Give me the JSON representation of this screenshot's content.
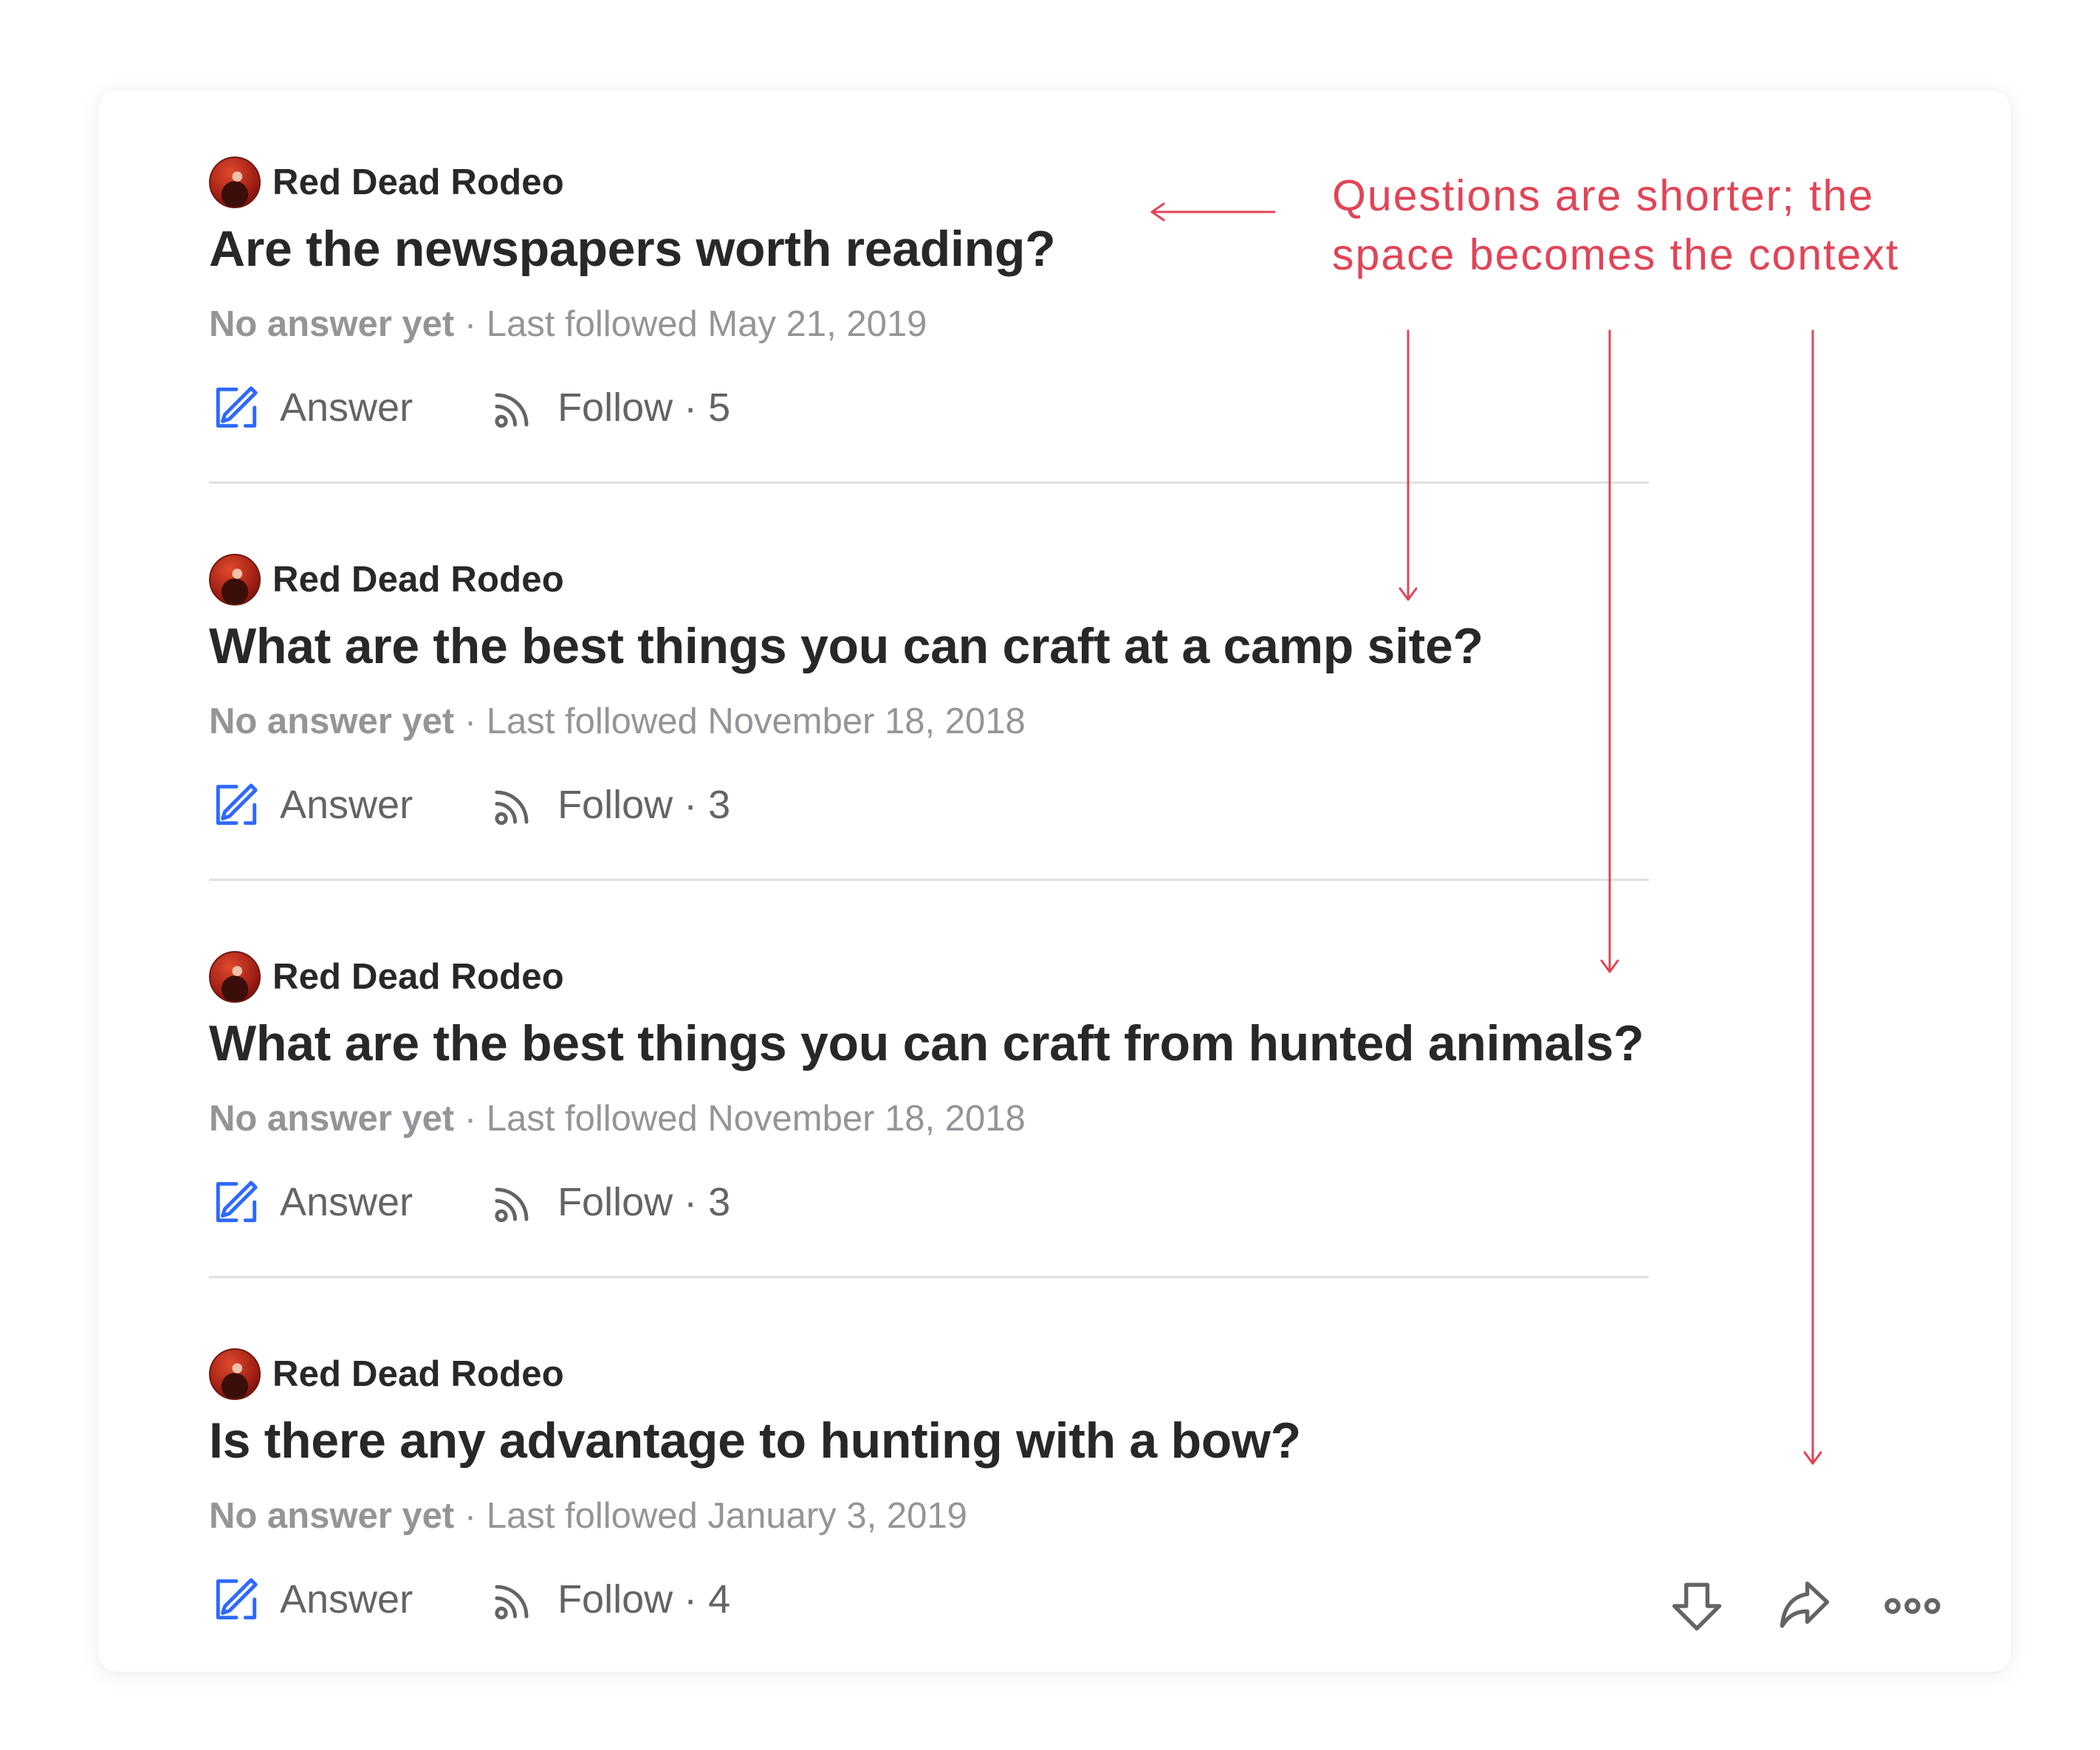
{
  "questions": [
    {
      "source": "Red Dead Rodeo",
      "title": "Are the newspapers worth reading?",
      "status": "No answer yet",
      "last_followed": " · Last followed May 21, 2019",
      "answer_label": "Answer",
      "follow_label": "Follow",
      "follow_count": " · 5"
    },
    {
      "source": "Red Dead Rodeo",
      "title": "What are the best things you can craft at a camp site?",
      "status": "No answer yet",
      "last_followed": " · Last followed November 18, 2018",
      "answer_label": "Answer",
      "follow_label": "Follow",
      "follow_count": " · 3"
    },
    {
      "source": "Red Dead Rodeo",
      "title": "What are the best things you can craft from hunted animals?",
      "status": "No answer yet",
      "last_followed": " · Last followed November 18, 2018",
      "answer_label": "Answer",
      "follow_label": "Follow",
      "follow_count": " · 3"
    },
    {
      "source": "Red Dead Rodeo",
      "title": "Is there any advantage to hunting with a bow?",
      "status": "No answer yet",
      "last_followed": " · Last followed January 3, 2019",
      "answer_label": "Answer",
      "follow_label": "Follow",
      "follow_count": " · 4"
    }
  ],
  "action_tray": {
    "icons": [
      "downvote-icon",
      "share-icon",
      "more-icon"
    ]
  },
  "annotation": {
    "line1": "Questions are shorter; the",
    "line2": "space becomes the context"
  },
  "colors": {
    "accent_blue": "#2e69ff",
    "annotation_red": "#e14456",
    "title_text": "#282829",
    "meta_text": "#939598",
    "action_text": "#636466"
  }
}
